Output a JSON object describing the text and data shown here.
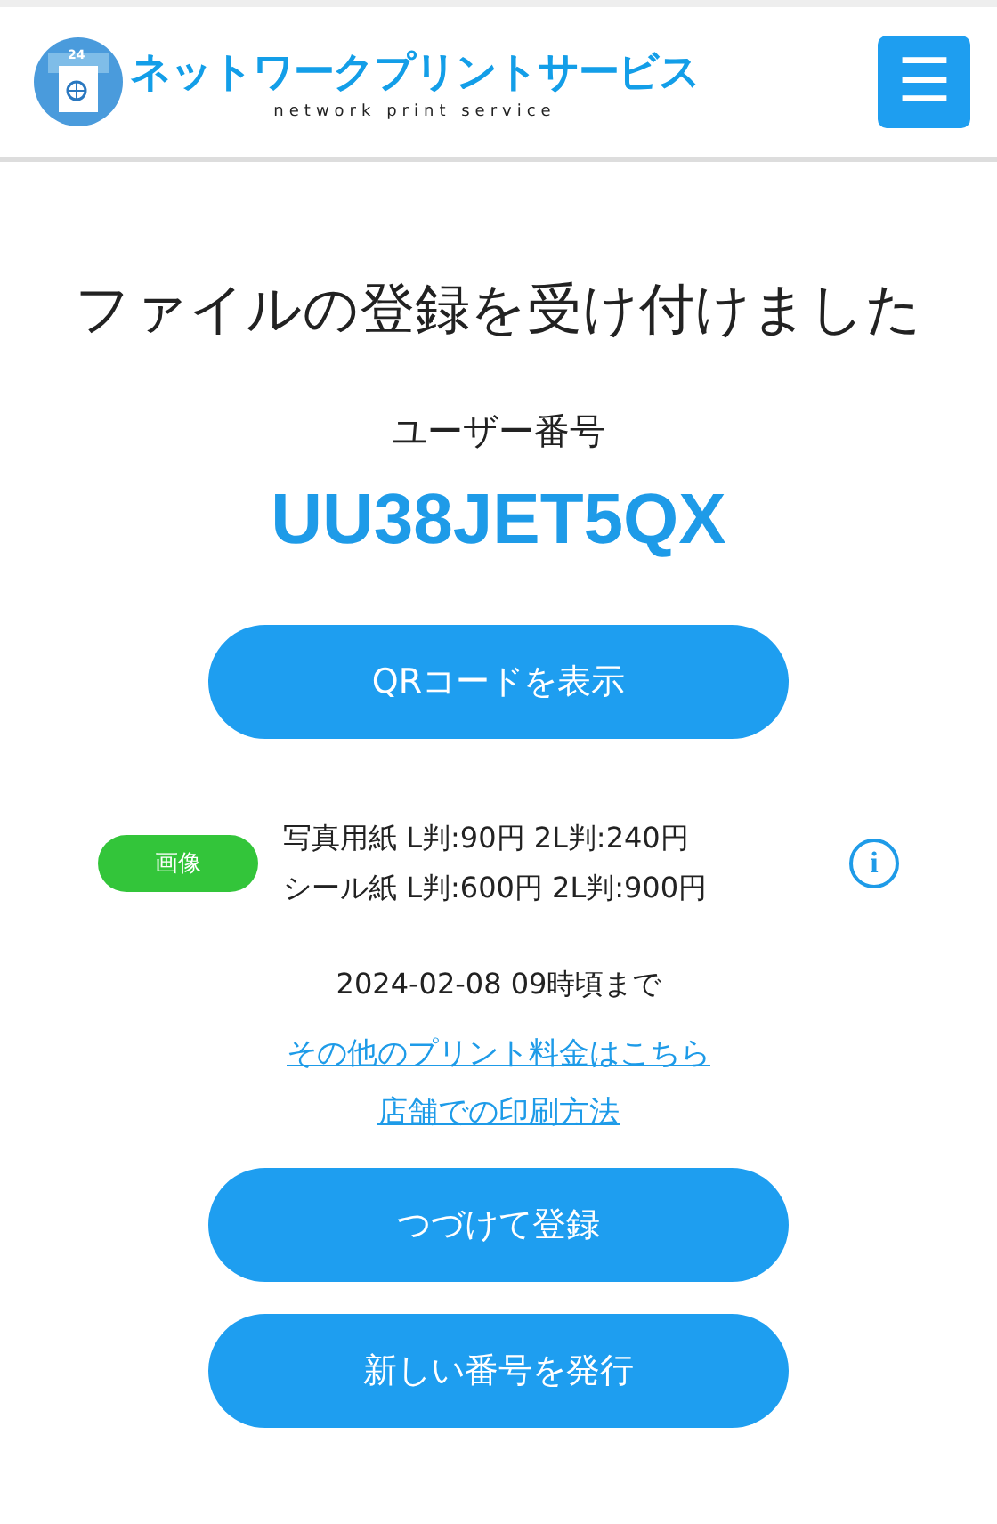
{
  "header": {
    "logo_badge": "24",
    "logo_title": "ネットワークプリントサービス",
    "logo_subtitle": "network print service",
    "menu_icon": "☰"
  },
  "title": "ファイルの登録を受け付けました",
  "user_number_label": "ユーザー番号",
  "user_number": "UU38JET5QX",
  "qr_button": "QRコードを表示",
  "file": {
    "type_tag": "画像",
    "color": "#33c53a",
    "prices": [
      "写真用紙 L判:90円 2L判:240円",
      "シール紙 L判:600円 2L判:900円"
    ],
    "info_icon": "i"
  },
  "deadline": "2024-02-08 09時頃まで",
  "links": [
    "その他のプリント料金はこちら",
    "店舗での印刷方法"
  ],
  "buttons": [
    "つづけて登録",
    "新しい番号を発行"
  ]
}
